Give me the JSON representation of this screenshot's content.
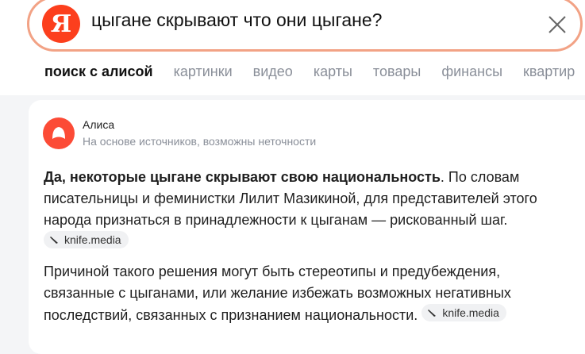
{
  "search": {
    "logo_letter": "Я",
    "query": "цыгане скрывают что они цыгане?"
  },
  "tabs": [
    {
      "label": "поиск с алисой",
      "active": true
    },
    {
      "label": "картинки",
      "active": false
    },
    {
      "label": "видео",
      "active": false
    },
    {
      "label": "карты",
      "active": false
    },
    {
      "label": "товары",
      "active": false
    },
    {
      "label": "финансы",
      "active": false
    },
    {
      "label": "квартир",
      "active": false
    }
  ],
  "answer": {
    "author": "Алиса",
    "subtitle": "На основе источников, возможны неточности",
    "p1_bold": "Да, некоторые цыгане скрывают свою национальность",
    "p1_rest": ". По словам писательницы и феминистки Лилит Мазикиной, для представителей этого народа признаться в принадлежности к цыганам — рискованный шаг.",
    "p2": "Причиной такого решения могут быть стереотипы и предубеждения, связанные с цыганами, или желание избежать возможных негативных последствий, связанных с признанием национальности.",
    "sources": [
      {
        "label": "knife.media",
        "icon": "knife-icon"
      },
      {
        "label": "knife.media",
        "icon": "knife-icon"
      }
    ]
  },
  "colors": {
    "brand_red": "#fc3f1d",
    "alice_red": "#fc4b36",
    "search_border": "#f2a285",
    "muted_text": "#8a8f99"
  }
}
